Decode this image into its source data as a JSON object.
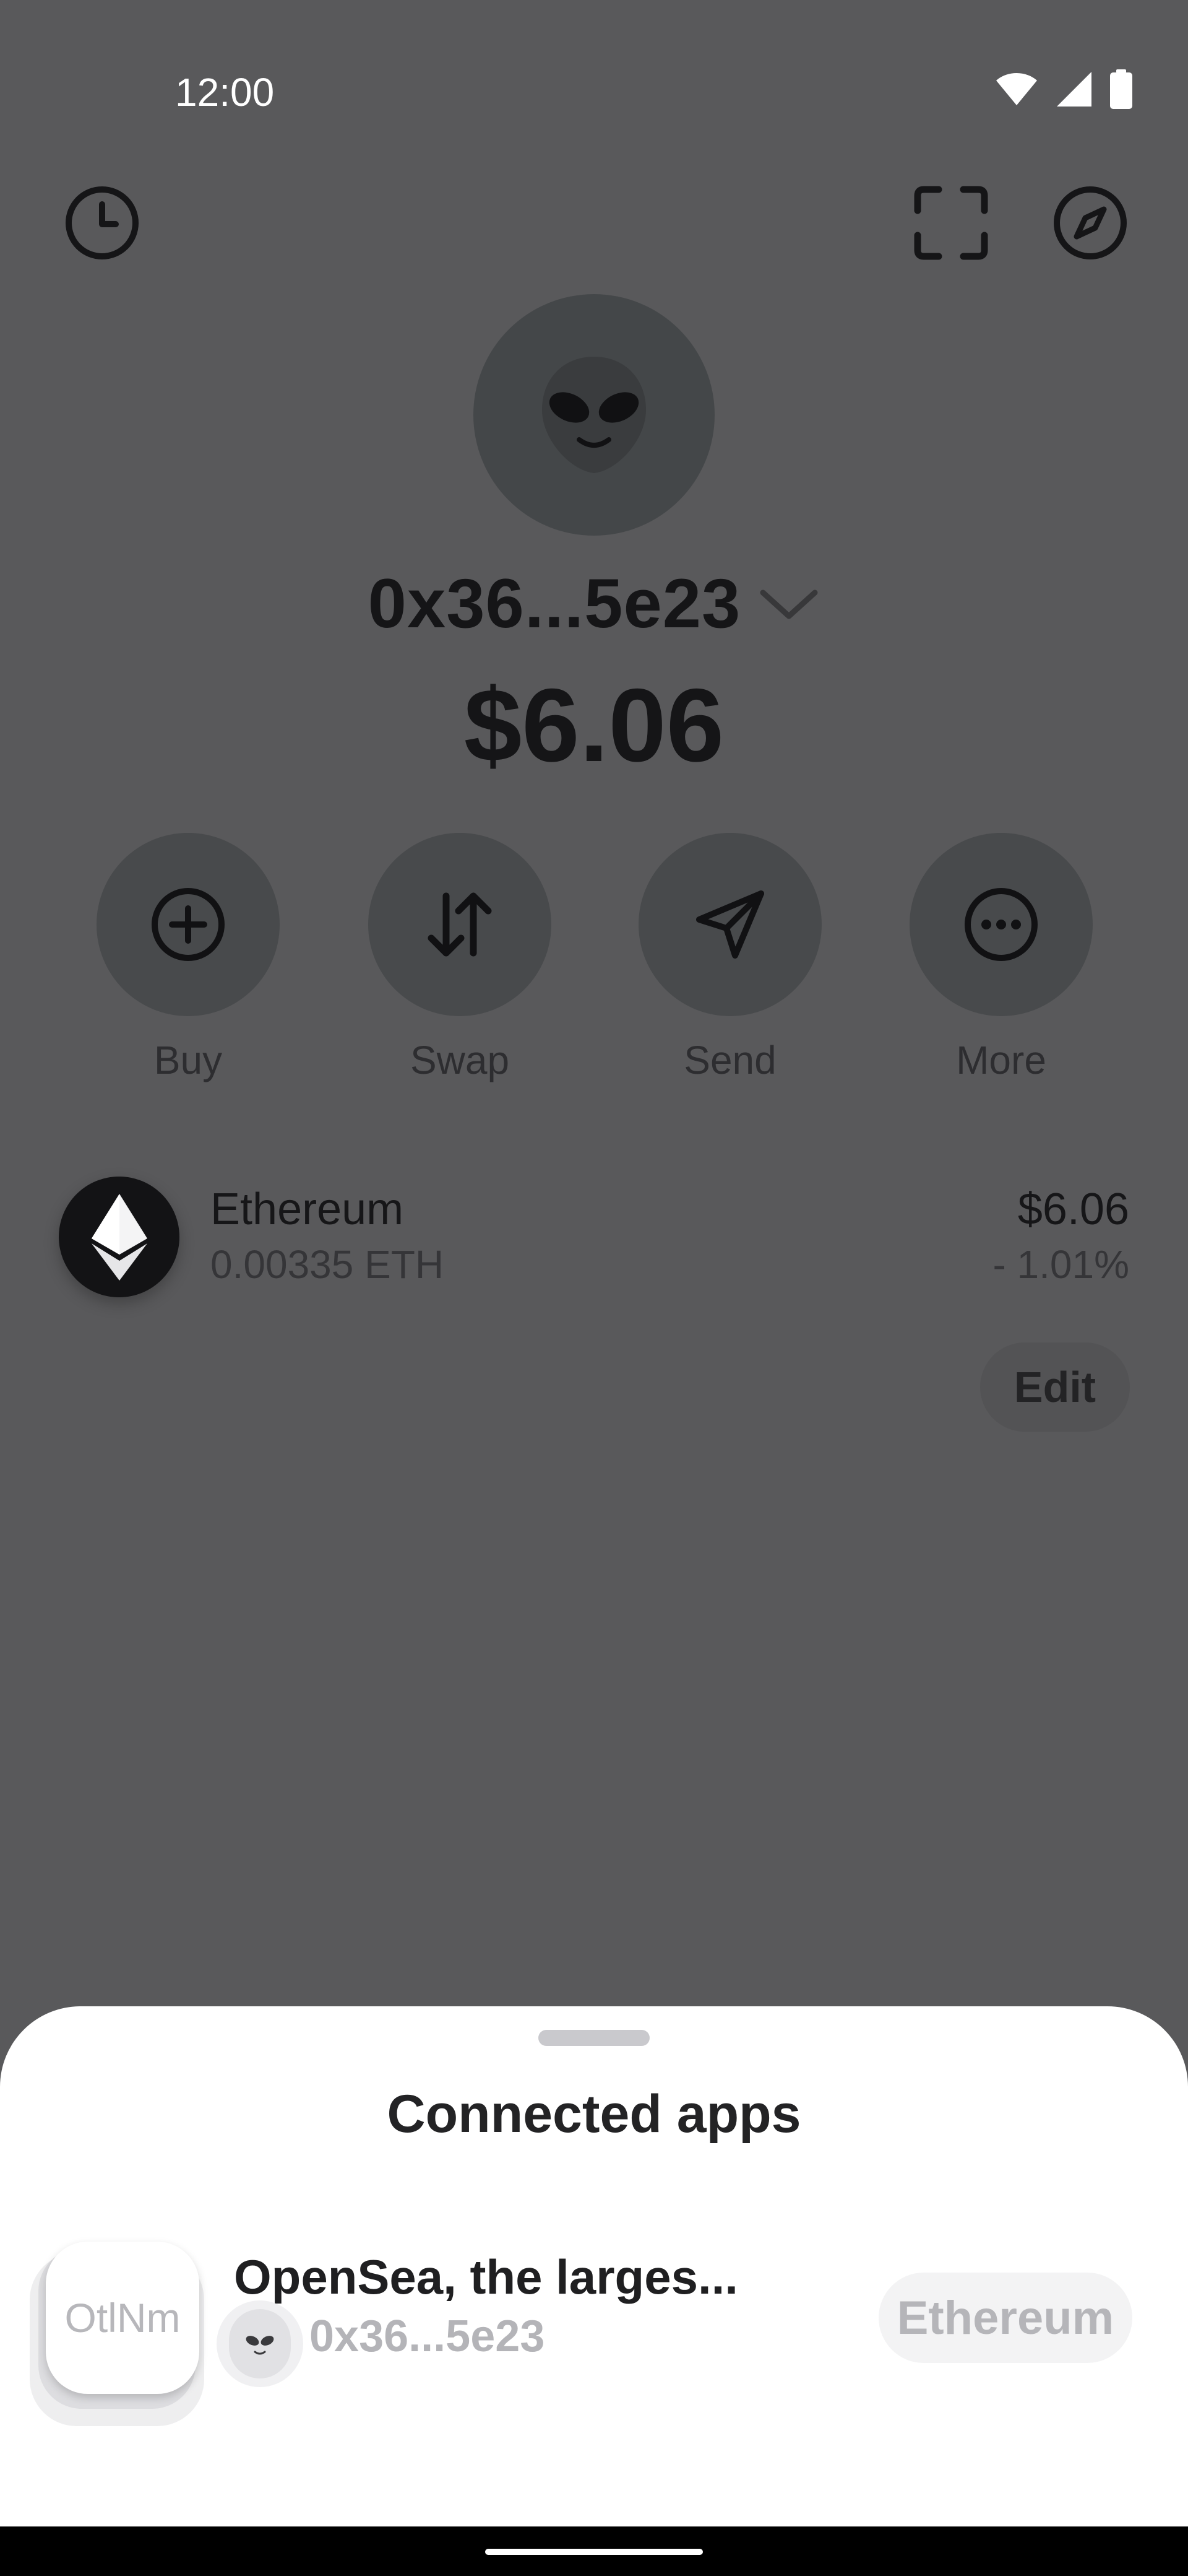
{
  "status_bar": {
    "time": "12:00"
  },
  "wallet": {
    "address": "0x36...5e23",
    "balance": "$6.06"
  },
  "actions": [
    {
      "label": "Buy",
      "icon": "plus-circle-icon"
    },
    {
      "label": "Swap",
      "icon": "swap-arrows-icon"
    },
    {
      "label": "Send",
      "icon": "send-plane-icon"
    },
    {
      "label": "More",
      "icon": "more-dots-icon"
    }
  ],
  "tokens": [
    {
      "name": "Ethereum",
      "amount": "0.00335 ETH",
      "value": "$6.06",
      "change": "- 1.01%",
      "icon": "ethereum-icon"
    }
  ],
  "edit_label": "Edit",
  "sheet": {
    "title": "Connected apps",
    "apps": [
      {
        "icon_text": "OtlNm",
        "name": "OpenSea, the larges...",
        "address": "0x36...5e23",
        "network": "Ethereum"
      }
    ]
  },
  "colors": {
    "overlay": "#59595b",
    "sheet": "#ffffff",
    "text_dark": "#151517",
    "muted": "#b5b5b9"
  }
}
